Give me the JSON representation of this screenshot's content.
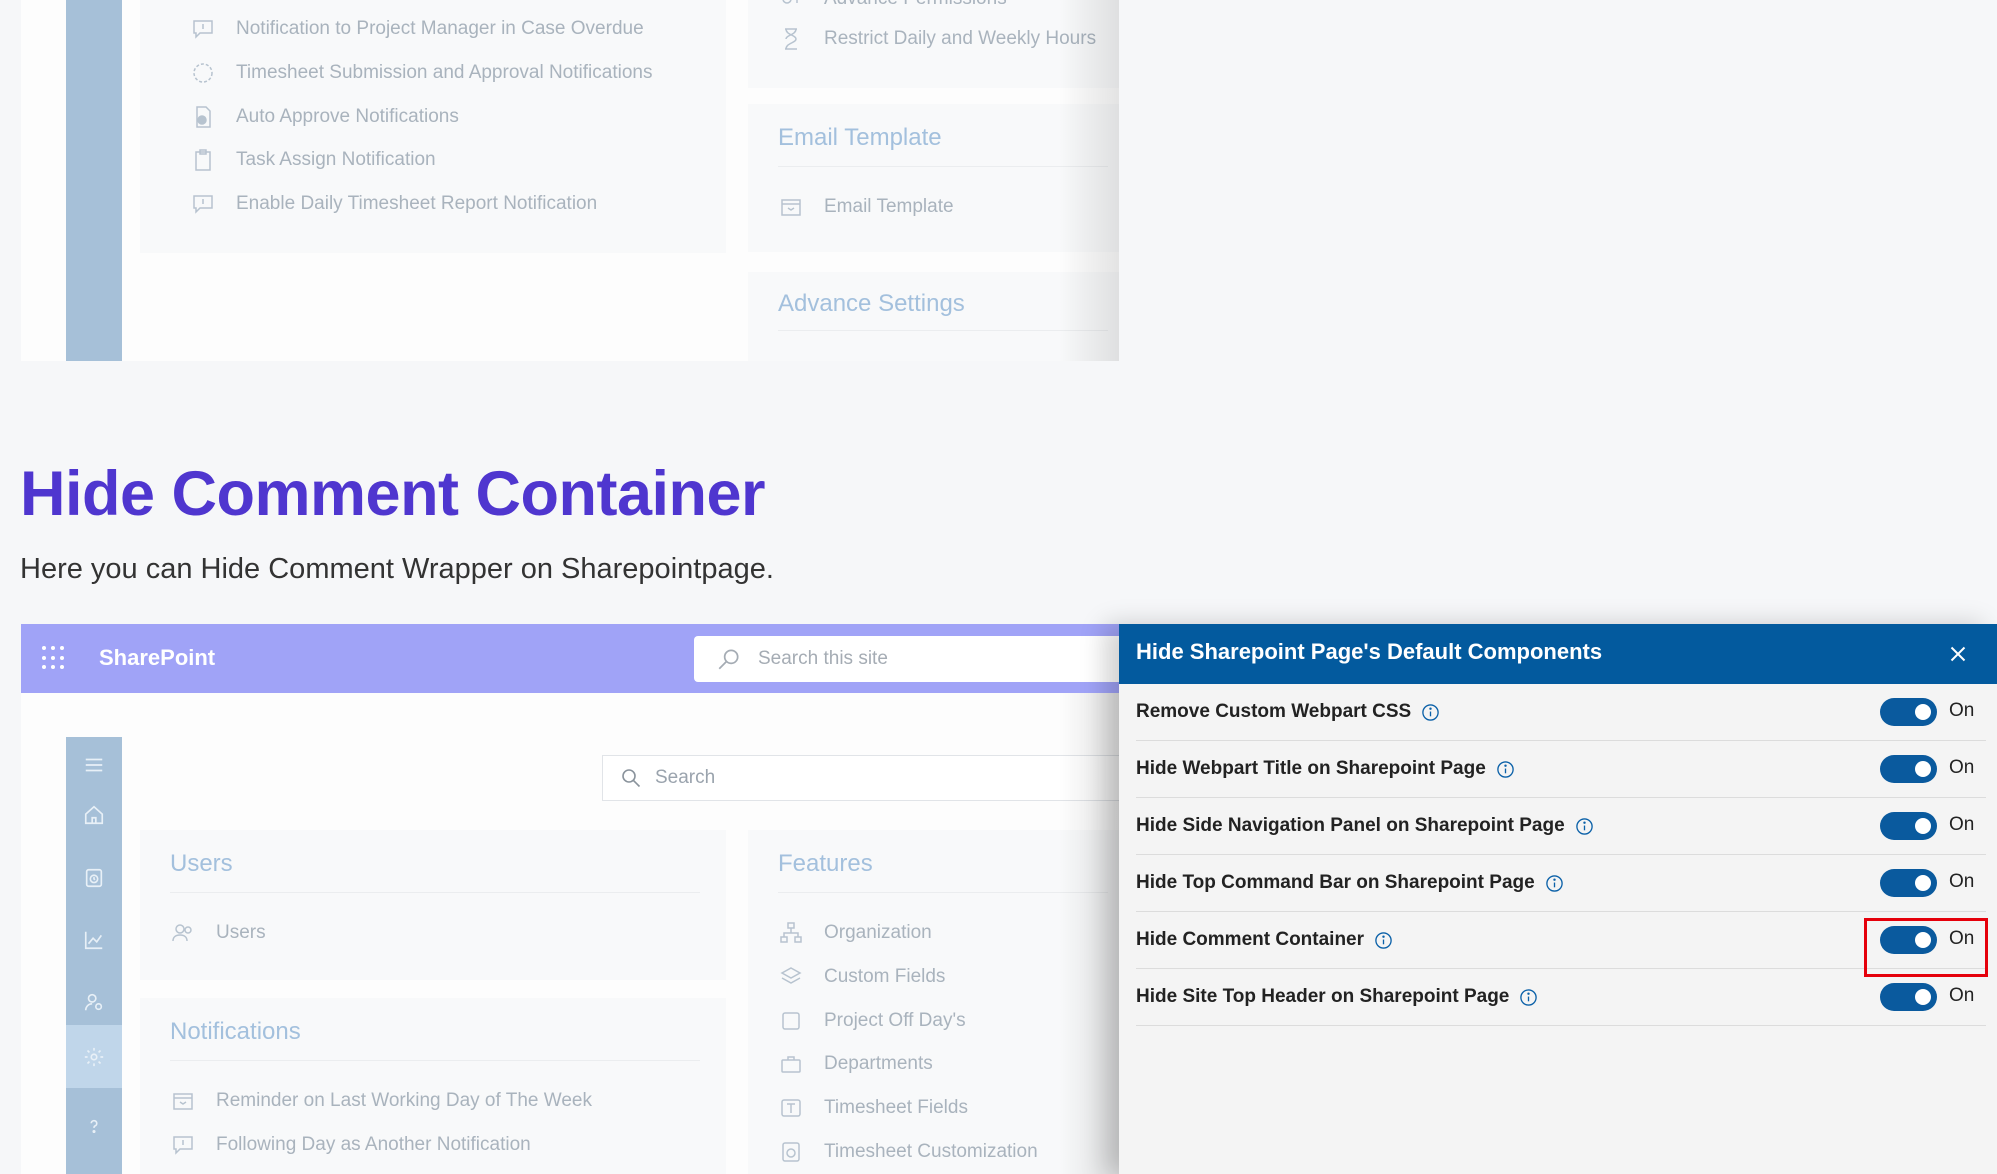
{
  "top_screenshot": {
    "notifications_items": [
      "Notification to Project Manager in Case Overdue",
      "Timesheet Submission and Approval Notifications",
      "Auto Approve Notifications",
      "Task Assign Notification",
      "Enable Daily Timesheet Report Notification"
    ],
    "features_partial": [
      "Advance Permissions",
      "Restrict Daily and Weekly Hours"
    ],
    "email_template_heading": "Email Template",
    "email_template_item": "Email Template",
    "advance_settings_heading": "Advance Settings"
  },
  "heading": "Hide Comment Container",
  "subheading": "Here you can Hide Comment Wrapper on Sharepointpage.",
  "sharepoint": {
    "brand": "SharePoint",
    "site_search_placeholder": "Search this site",
    "inner_search_placeholder": "Search",
    "users_heading": "Users",
    "users_item": "Users",
    "notifications_heading": "Notifications",
    "notifications_items": [
      "Reminder on Last Working Day of The Week",
      "Following Day as Another Notification"
    ],
    "features_heading": "Features",
    "features_items": [
      "Organization",
      "Custom Fields",
      "Project Off Day's",
      "Departments",
      "Timesheet Fields",
      "Timesheet Customization"
    ],
    "nav_icons": [
      "menu-icon",
      "home-icon",
      "timesheet-icon",
      "chart-icon",
      "user-settings-icon",
      "gear-icon",
      "help-icon"
    ]
  },
  "panel": {
    "title": "Hide Sharepoint Page's Default Components",
    "settings": [
      {
        "label": "Remove Custom Webpart CSS",
        "state": "On"
      },
      {
        "label": "Hide Webpart Title on Sharepoint Page",
        "state": "On"
      },
      {
        "label": "Hide Side Navigation Panel on Sharepoint Page",
        "state": "On"
      },
      {
        "label": "Hide Top Command Bar on Sharepoint Page",
        "state": "On"
      },
      {
        "label": "Hide Comment Container",
        "state": "On",
        "highlighted": true
      },
      {
        "label": "Hide Site Top Header on Sharepoint Page",
        "state": "On"
      }
    ]
  },
  "colors": {
    "heading": "#4f36cf",
    "panel_header": "#035a9e",
    "toggle_on": "#0a5a9e",
    "highlight": "#e5000b",
    "sharepoint_bar": "#a0a3f7"
  }
}
